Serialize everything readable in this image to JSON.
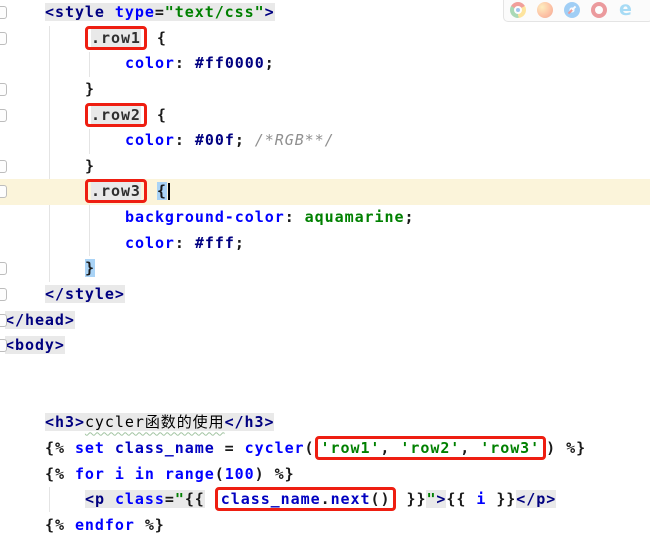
{
  "app": "code-editor",
  "colors": {
    "annotation_red": "#ee1e11",
    "fragment_chip_gray": "#e9e9e9",
    "current_line_cream": "#fbf4da",
    "brace_match_blue": "#a9d3f6",
    "tag_navy": "#000080",
    "keyword_blue": "#0000ff",
    "string_green": "#008000",
    "comment_gray": "#909090"
  },
  "browser_toolbar": {
    "icons": [
      "chrome-icon",
      "firefox-icon",
      "safari-icon",
      "opera-icon",
      "ie-icon"
    ]
  },
  "code": {
    "lines": [
      {
        "indent": 1,
        "gutter_icon": true,
        "segments": [
          {
            "t": "<style ",
            "c": "tag",
            "chip": true
          },
          {
            "t": "type",
            "c": "attr",
            "chip": true
          },
          {
            "t": "=",
            "c": "pun",
            "chip": true
          },
          {
            "t": "\"text/css\"",
            "c": "str",
            "chip": true
          },
          {
            "t": ">",
            "c": "tag",
            "chip": true
          }
        ]
      },
      {
        "indent": 2,
        "gutter_icon": true,
        "segments": [
          {
            "t": ".row1",
            "c": "sel",
            "chip": true,
            "box": true
          },
          {
            "t": " ",
            "c": "pun"
          },
          {
            "t": "{",
            "c": "pun"
          }
        ]
      },
      {
        "indent": 3,
        "segments": [
          {
            "t": "color",
            "c": "prop"
          },
          {
            "t": ": ",
            "c": "pun"
          },
          {
            "t": "#ff0000",
            "c": "val"
          },
          {
            "t": ";",
            "c": "pun"
          }
        ]
      },
      {
        "indent": 2,
        "gutter_icon": true,
        "segments": [
          {
            "t": "}",
            "c": "pun"
          }
        ]
      },
      {
        "indent": 2,
        "gutter_icon": true,
        "segments": [
          {
            "t": ".row2",
            "c": "sel",
            "chip": true,
            "box": true
          },
          {
            "t": " ",
            "c": "pun"
          },
          {
            "t": "{",
            "c": "pun"
          }
        ]
      },
      {
        "indent": 3,
        "segments": [
          {
            "t": "color",
            "c": "prop"
          },
          {
            "t": ": ",
            "c": "pun"
          },
          {
            "t": "#00f",
            "c": "val"
          },
          {
            "t": "; ",
            "c": "pun"
          },
          {
            "t": "/*RGB**/",
            "c": "cmt"
          }
        ]
      },
      {
        "indent": 2,
        "gutter_icon": true,
        "segments": [
          {
            "t": "}",
            "c": "pun"
          }
        ]
      },
      {
        "indent": 2,
        "gutter_icon": true,
        "current": true,
        "segments": [
          {
            "t": ".row3",
            "c": "sel",
            "chip": true,
            "box": true
          },
          {
            "t": " ",
            "c": "pun"
          },
          {
            "t": "{",
            "c": "pun",
            "selbg": true,
            "caret": true
          }
        ]
      },
      {
        "indent": 3,
        "segments": [
          {
            "t": "background-color",
            "c": "prop"
          },
          {
            "t": ": ",
            "c": "pun"
          },
          {
            "t": "aquamarine",
            "c": "kwval"
          },
          {
            "t": ";",
            "c": "pun"
          }
        ]
      },
      {
        "indent": 3,
        "segments": [
          {
            "t": "color",
            "c": "prop"
          },
          {
            "t": ": ",
            "c": "pun"
          },
          {
            "t": "#fff",
            "c": "val"
          },
          {
            "t": ";",
            "c": "pun"
          }
        ]
      },
      {
        "indent": 2,
        "gutter_icon": true,
        "segments": [
          {
            "t": "}",
            "c": "pun",
            "selbg": true
          }
        ]
      },
      {
        "indent": 1,
        "gutter_icon": true,
        "segments": [
          {
            "t": "</style>",
            "c": "tag",
            "chip": true
          }
        ]
      },
      {
        "indent": 0,
        "gutter_icon": true,
        "segments": [
          {
            "t": "</head>",
            "c": "tag",
            "chip": true
          }
        ]
      },
      {
        "indent": 0,
        "gutter_icon": true,
        "segments": [
          {
            "t": "<body>",
            "c": "tag",
            "chip": true
          }
        ]
      },
      {
        "indent": 0,
        "segments": []
      },
      {
        "indent": 0,
        "segments": []
      },
      {
        "indent": 1,
        "segments": [
          {
            "t": "<h3>",
            "c": "tag",
            "chip": true
          },
          {
            "t": "cycler函数的使用",
            "c": "txt",
            "chip": true,
            "wavy": true
          },
          {
            "t": "</h3>",
            "c": "tag",
            "chip": true
          }
        ]
      },
      {
        "indent": 1,
        "segments": [
          {
            "t": "{% ",
            "c": "pun"
          },
          {
            "t": "set",
            "c": "kw"
          },
          {
            "t": " ",
            "c": "pun"
          },
          {
            "t": "class_name",
            "c": "id"
          },
          {
            "t": " = ",
            "c": "pun"
          },
          {
            "t": "cycler",
            "c": "kw"
          },
          {
            "t": "(",
            "c": "pun"
          },
          {
            "t": "'row1'",
            "c": "str",
            "box": true
          },
          {
            "t": ", ",
            "c": "pun",
            "box": true
          },
          {
            "t": "'row2'",
            "c": "str",
            "box": true
          },
          {
            "t": ", ",
            "c": "pun",
            "box": true
          },
          {
            "t": "'row3'",
            "c": "str",
            "box": true
          },
          {
            "t": ") ",
            "c": "pun"
          },
          {
            "t": "%}",
            "c": "pun"
          }
        ]
      },
      {
        "indent": 1,
        "segments": [
          {
            "t": "{% ",
            "c": "pun"
          },
          {
            "t": "for",
            "c": "kw"
          },
          {
            "t": " ",
            "c": "pun"
          },
          {
            "t": "i",
            "c": "var"
          },
          {
            "t": " ",
            "c": "pun"
          },
          {
            "t": "in",
            "c": "kw"
          },
          {
            "t": " ",
            "c": "pun"
          },
          {
            "t": "range",
            "c": "kw"
          },
          {
            "t": "(",
            "c": "pun"
          },
          {
            "t": "100",
            "c": "num"
          },
          {
            "t": ") ",
            "c": "pun"
          },
          {
            "t": "%}",
            "c": "pun"
          }
        ]
      },
      {
        "indent": 2,
        "segments": [
          {
            "t": "<p ",
            "c": "tag",
            "chip": true
          },
          {
            "t": "class",
            "c": "attr",
            "chip": true
          },
          {
            "t": "=",
            "c": "pun",
            "chip": true
          },
          {
            "t": "\"",
            "c": "str",
            "chip": true
          },
          {
            "t": "{{",
            "c": "pun",
            "chip": true
          },
          {
            "t": " ",
            "c": "pun"
          },
          {
            "t": "class_name",
            "c": "id",
            "box": true
          },
          {
            "t": ".",
            "c": "pun",
            "box": true
          },
          {
            "t": "next",
            "c": "id",
            "box": true
          },
          {
            "t": "()",
            "c": "pun",
            "box": true
          },
          {
            "t": " }}",
            "c": "pun"
          },
          {
            "t": "\"",
            "c": "str",
            "chip": true
          },
          {
            "t": ">",
            "c": "tag",
            "chip": true
          },
          {
            "t": "{{ ",
            "c": "pun"
          },
          {
            "t": "i",
            "c": "var"
          },
          {
            "t": " }}",
            "c": "pun"
          },
          {
            "t": "</p>",
            "c": "tag",
            "chip": true
          }
        ]
      },
      {
        "indent": 1,
        "segments": [
          {
            "t": "{% ",
            "c": "pun"
          },
          {
            "t": "endfor",
            "c": "kw"
          },
          {
            "t": " %}",
            "c": "pun"
          }
        ]
      }
    ]
  }
}
